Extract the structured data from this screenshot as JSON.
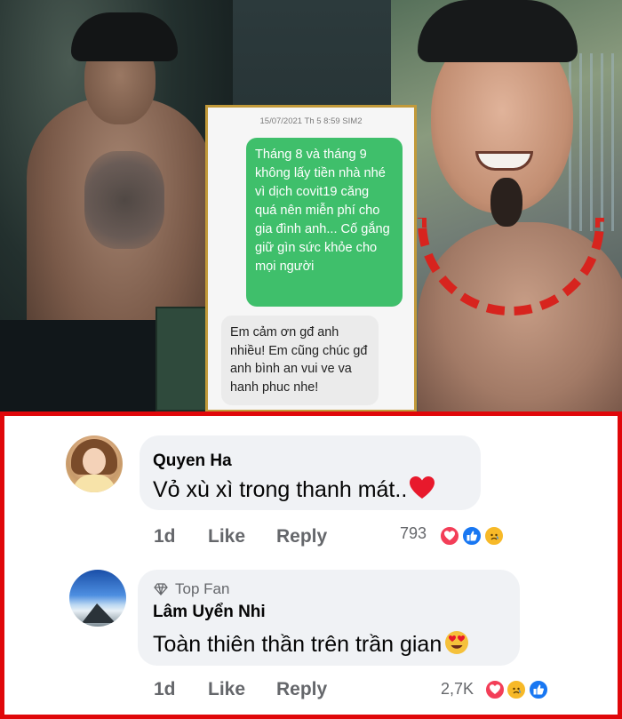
{
  "sms": {
    "date_line": "15/07/2021 Th 5 8:59  SIM2",
    "sent_text": "Tháng 8 và tháng 9 không lấy tiền nhà nhé vì dịch covit19 căng quá nên miễn phí cho gia đình anh... Cố gắng giữ gìn sức khỏe cho mọi người",
    "received_text": "Em cảm ơn gđ anh nhiều! Em cũng chúc gđ anh bình an vui ve va hanh phuc nhe!"
  },
  "comments": [
    {
      "author": "Quyen Ha",
      "text": "Vỏ xù xì trong thanh mát..",
      "text_emoji": "red-heart",
      "time": "1d",
      "like_label": "Like",
      "reply_label": "Reply",
      "reaction_count": "793",
      "reactions": [
        "love",
        "like",
        "sad"
      ]
    },
    {
      "badge": "Top Fan",
      "author": "Lâm Uyển Nhi",
      "text": "Toàn thiên thần trên trần gian",
      "text_emoji": "heart-eyes",
      "time": "1d",
      "like_label": "Like",
      "reply_label": "Reply",
      "reaction_count": "2,7K",
      "reactions": [
        "love",
        "sad",
        "like"
      ]
    }
  ],
  "colors": {
    "frame_red": "#e0070a",
    "sms_sent": "#3fbf6b",
    "card_border": "#c29a3a",
    "love": "#f33e58",
    "like": "#1877f2",
    "sad": "#f7b928"
  }
}
